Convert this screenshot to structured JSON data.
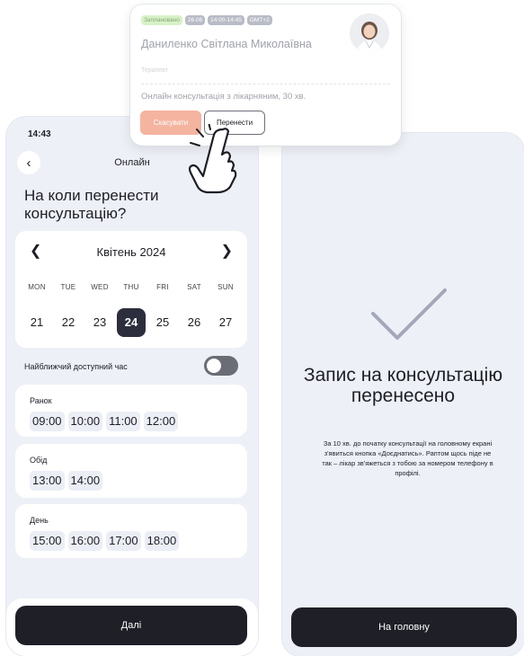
{
  "left_screen": {
    "status_time": "14:43",
    "nav_title": "Онлайн",
    "heading": "На коли перенести консультацію?",
    "calendar": {
      "month": "Квітень 2024",
      "weekdays": [
        "MON",
        "TUE",
        "WED",
        "THU",
        "FRI",
        "SAT",
        "SUN"
      ],
      "days": [
        "21",
        "22",
        "23",
        "24",
        "25",
        "26",
        "27"
      ],
      "selected_day": "24"
    },
    "nearest_label": "Найближчий доступний час",
    "nearest_toggle_on": false,
    "slot_groups": [
      {
        "title": "Ранок",
        "slots": [
          "09:00",
          "10:00",
          "11:00",
          "12:00"
        ]
      },
      {
        "title": "Обід",
        "slots": [
          "13:00",
          "14:00"
        ]
      },
      {
        "title": "День",
        "slots": [
          "15:00",
          "16:00",
          "17:00",
          "18:00"
        ]
      }
    ],
    "next_button": "Далі"
  },
  "right_screen": {
    "success_title": "Запис на консультацію перенесено",
    "success_text": "За 10 хв. до початку консультації на головному екрані з'явиться кнопка «Доєднатись». Раптом щось піде не так – лікар зв'яжеться з тобою за номером телефону в профілі.",
    "home_button": "На головну",
    "icon": "checkmark-icon"
  },
  "appointment_card": {
    "badges": [
      "Заплановано",
      "26.06",
      "14:00-14:45",
      "GMT+2"
    ],
    "doctor_name": "Даниленко Світлана Миколаївна",
    "doctor_role": "Терапевт",
    "description": "Онлайн консультація з лікарняним, 30 хв.",
    "cancel_button": "Скасувати",
    "reschedule_button": "Перенести"
  },
  "colors": {
    "background": "#eef0f7",
    "dark_button": "#1e1f27",
    "selected_day": "#2c2e3e",
    "cancel_button": "#f4b4a0",
    "status_badge": "#d8f1c7",
    "checkmark": "#a3a8b8"
  }
}
